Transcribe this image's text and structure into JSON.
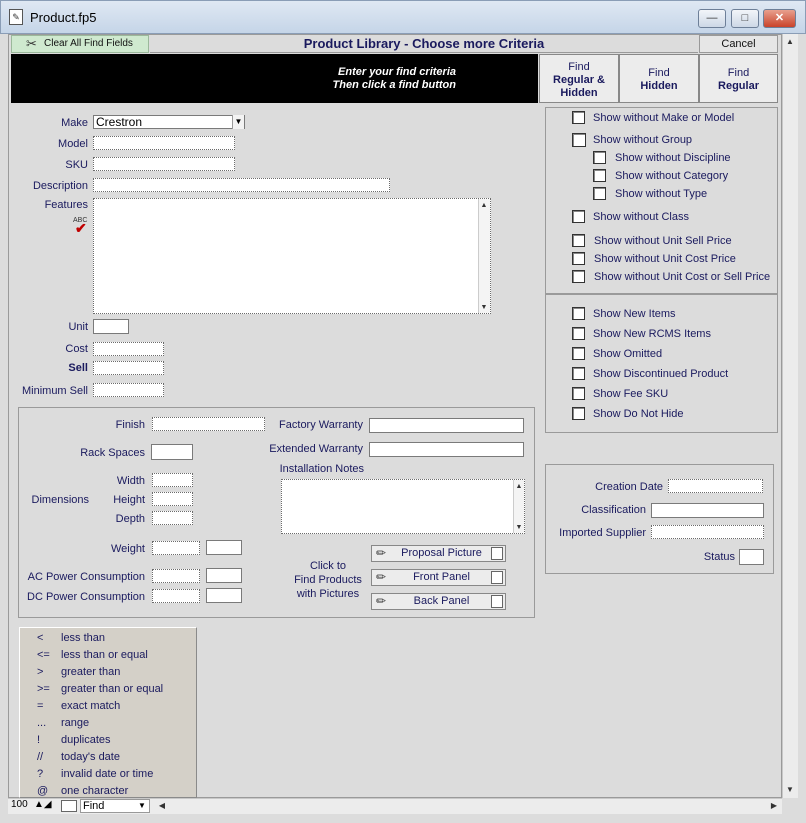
{
  "window": {
    "title": "Product.fp5",
    "minimize": "—",
    "maximize": "□",
    "close": "✕"
  },
  "header": {
    "clear_label": "Clear All Find Fields",
    "title": "Product Library - Choose more Criteria",
    "cancel_label": "Cancel",
    "instructions_line1": "Enter your find criteria",
    "instructions_line2": "Then click a find button",
    "find_regular_hidden": {
      "line1": "Find",
      "line2": "Regular &",
      "line3": "Hidden"
    },
    "find_hidden": {
      "line1": "Find",
      "line2": "Hidden"
    },
    "find_regular": {
      "line1": "Find",
      "line2": "Regular"
    }
  },
  "form": {
    "make_label": "Make",
    "make_value": "Crestron",
    "model_label": "Model",
    "sku_label": "SKU",
    "description_label": "Description",
    "features_label": "Features",
    "spell_label": "ABC",
    "unit_label": "Unit",
    "cost_label": "Cost",
    "sell_label": "Sell",
    "minimum_sell_label": "Minimum Sell"
  },
  "details": {
    "finish_label": "Finish",
    "rack_spaces_label": "Rack Spaces",
    "dimensions_label": "Dimensions",
    "width_label": "Width",
    "height_label": "Height",
    "depth_label": "Depth",
    "weight_label": "Weight",
    "ac_power_label": "AC Power Consumption",
    "dc_power_label": "DC Power Consumption",
    "factory_warranty_label": "Factory Warranty",
    "extended_warranty_label": "Extended Warranty",
    "installation_notes_label": "Installation Notes",
    "pictures_line1": "Click to",
    "pictures_line2": "Find Products",
    "pictures_line3": "with Pictures",
    "proposal_picture": "Proposal Picture",
    "front_panel": "Front Panel",
    "back_panel": "Back Panel"
  },
  "options_without": [
    "Show without Make or Model",
    "Show without Group",
    "Show without Discipline",
    "Show without Category",
    "Show without Type",
    "Show without Class",
    "Show without Unit Sell Price",
    "Show without Unit Cost Price",
    "Show without Unit Cost or Sell Price"
  ],
  "options_show": [
    "Show New Items",
    "Show New RCMS Items",
    "Show Omitted",
    "Show Discontinued Product",
    "Show Fee SKU",
    "Show Do Not Hide"
  ],
  "meta": {
    "creation_date_label": "Creation Date",
    "classification_label": "Classification",
    "imported_supplier_label": "Imported Supplier",
    "status_label": "Status"
  },
  "legend": [
    {
      "sym": "<",
      "desc": "less than"
    },
    {
      "sym": "<=",
      "desc": "less than or equal"
    },
    {
      "sym": ">",
      "desc": "greater than"
    },
    {
      "sym": ">=",
      "desc": "greater than or equal"
    },
    {
      "sym": "=",
      "desc": "exact match"
    },
    {
      "sym": "...",
      "desc": "range"
    },
    {
      "sym": "!",
      "desc": "duplicates"
    },
    {
      "sym": "//",
      "desc": "today's date"
    },
    {
      "sym": "?",
      "desc": "invalid date or time"
    },
    {
      "sym": "@",
      "desc": "one character"
    }
  ],
  "statusbar": {
    "zoom": "100",
    "mode": "Find"
  }
}
